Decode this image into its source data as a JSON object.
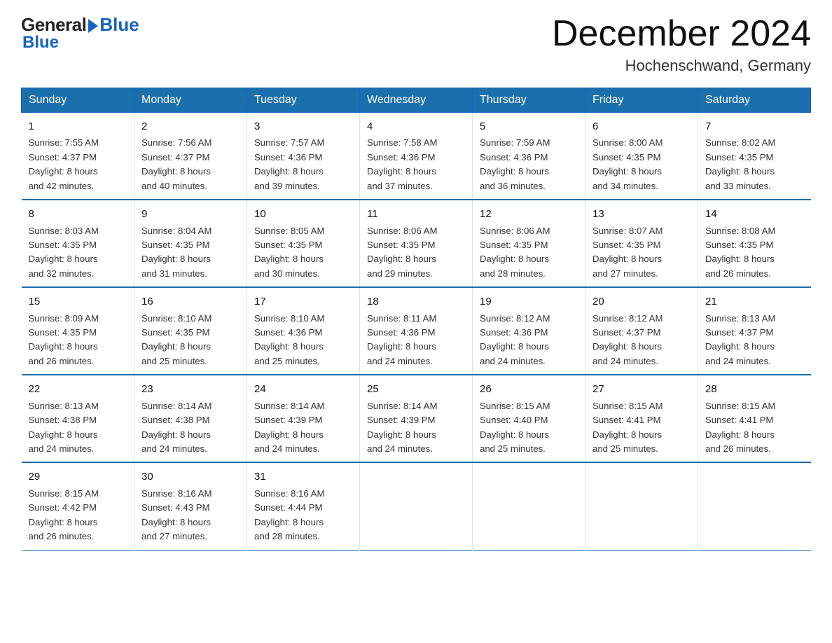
{
  "logo": {
    "general": "General",
    "blue": "Blue"
  },
  "title": {
    "month": "December 2024",
    "location": "Hochenschwand, Germany"
  },
  "weekdays": [
    "Sunday",
    "Monday",
    "Tuesday",
    "Wednesday",
    "Thursday",
    "Friday",
    "Saturday"
  ],
  "weeks": [
    [
      {
        "day": "1",
        "info": "Sunrise: 7:55 AM\nSunset: 4:37 PM\nDaylight: 8 hours\nand 42 minutes."
      },
      {
        "day": "2",
        "info": "Sunrise: 7:56 AM\nSunset: 4:37 PM\nDaylight: 8 hours\nand 40 minutes."
      },
      {
        "day": "3",
        "info": "Sunrise: 7:57 AM\nSunset: 4:36 PM\nDaylight: 8 hours\nand 39 minutes."
      },
      {
        "day": "4",
        "info": "Sunrise: 7:58 AM\nSunset: 4:36 PM\nDaylight: 8 hours\nand 37 minutes."
      },
      {
        "day": "5",
        "info": "Sunrise: 7:59 AM\nSunset: 4:36 PM\nDaylight: 8 hours\nand 36 minutes."
      },
      {
        "day": "6",
        "info": "Sunrise: 8:00 AM\nSunset: 4:35 PM\nDaylight: 8 hours\nand 34 minutes."
      },
      {
        "day": "7",
        "info": "Sunrise: 8:02 AM\nSunset: 4:35 PM\nDaylight: 8 hours\nand 33 minutes."
      }
    ],
    [
      {
        "day": "8",
        "info": "Sunrise: 8:03 AM\nSunset: 4:35 PM\nDaylight: 8 hours\nand 32 minutes."
      },
      {
        "day": "9",
        "info": "Sunrise: 8:04 AM\nSunset: 4:35 PM\nDaylight: 8 hours\nand 31 minutes."
      },
      {
        "day": "10",
        "info": "Sunrise: 8:05 AM\nSunset: 4:35 PM\nDaylight: 8 hours\nand 30 minutes."
      },
      {
        "day": "11",
        "info": "Sunrise: 8:06 AM\nSunset: 4:35 PM\nDaylight: 8 hours\nand 29 minutes."
      },
      {
        "day": "12",
        "info": "Sunrise: 8:06 AM\nSunset: 4:35 PM\nDaylight: 8 hours\nand 28 minutes."
      },
      {
        "day": "13",
        "info": "Sunrise: 8:07 AM\nSunset: 4:35 PM\nDaylight: 8 hours\nand 27 minutes."
      },
      {
        "day": "14",
        "info": "Sunrise: 8:08 AM\nSunset: 4:35 PM\nDaylight: 8 hours\nand 26 minutes."
      }
    ],
    [
      {
        "day": "15",
        "info": "Sunrise: 8:09 AM\nSunset: 4:35 PM\nDaylight: 8 hours\nand 26 minutes."
      },
      {
        "day": "16",
        "info": "Sunrise: 8:10 AM\nSunset: 4:35 PM\nDaylight: 8 hours\nand 25 minutes."
      },
      {
        "day": "17",
        "info": "Sunrise: 8:10 AM\nSunset: 4:36 PM\nDaylight: 8 hours\nand 25 minutes."
      },
      {
        "day": "18",
        "info": "Sunrise: 8:11 AM\nSunset: 4:36 PM\nDaylight: 8 hours\nand 24 minutes."
      },
      {
        "day": "19",
        "info": "Sunrise: 8:12 AM\nSunset: 4:36 PM\nDaylight: 8 hours\nand 24 minutes."
      },
      {
        "day": "20",
        "info": "Sunrise: 8:12 AM\nSunset: 4:37 PM\nDaylight: 8 hours\nand 24 minutes."
      },
      {
        "day": "21",
        "info": "Sunrise: 8:13 AM\nSunset: 4:37 PM\nDaylight: 8 hours\nand 24 minutes."
      }
    ],
    [
      {
        "day": "22",
        "info": "Sunrise: 8:13 AM\nSunset: 4:38 PM\nDaylight: 8 hours\nand 24 minutes."
      },
      {
        "day": "23",
        "info": "Sunrise: 8:14 AM\nSunset: 4:38 PM\nDaylight: 8 hours\nand 24 minutes."
      },
      {
        "day": "24",
        "info": "Sunrise: 8:14 AM\nSunset: 4:39 PM\nDaylight: 8 hours\nand 24 minutes."
      },
      {
        "day": "25",
        "info": "Sunrise: 8:14 AM\nSunset: 4:39 PM\nDaylight: 8 hours\nand 24 minutes."
      },
      {
        "day": "26",
        "info": "Sunrise: 8:15 AM\nSunset: 4:40 PM\nDaylight: 8 hours\nand 25 minutes."
      },
      {
        "day": "27",
        "info": "Sunrise: 8:15 AM\nSunset: 4:41 PM\nDaylight: 8 hours\nand 25 minutes."
      },
      {
        "day": "28",
        "info": "Sunrise: 8:15 AM\nSunset: 4:41 PM\nDaylight: 8 hours\nand 26 minutes."
      }
    ],
    [
      {
        "day": "29",
        "info": "Sunrise: 8:15 AM\nSunset: 4:42 PM\nDaylight: 8 hours\nand 26 minutes."
      },
      {
        "day": "30",
        "info": "Sunrise: 8:16 AM\nSunset: 4:43 PM\nDaylight: 8 hours\nand 27 minutes."
      },
      {
        "day": "31",
        "info": "Sunrise: 8:16 AM\nSunset: 4:44 PM\nDaylight: 8 hours\nand 28 minutes."
      },
      {
        "day": "",
        "info": ""
      },
      {
        "day": "",
        "info": ""
      },
      {
        "day": "",
        "info": ""
      },
      {
        "day": "",
        "info": ""
      }
    ]
  ]
}
